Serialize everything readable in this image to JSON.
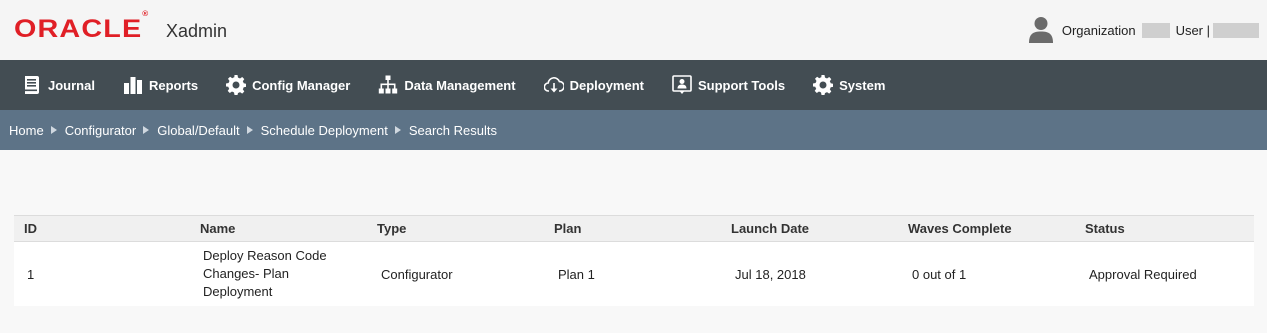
{
  "header": {
    "logo": "ORACLE",
    "logo_mark": "®",
    "app_name": "Xadmin",
    "org_label": "Organization",
    "user_label": "User |"
  },
  "nav": {
    "items": [
      {
        "label": "Journal",
        "icon": "journal-icon"
      },
      {
        "label": "Reports",
        "icon": "reports-icon"
      },
      {
        "label": "Config Manager",
        "icon": "gear-icon"
      },
      {
        "label": "Data Management",
        "icon": "hierarchy-icon"
      },
      {
        "label": "Deployment",
        "icon": "cloud-download-icon"
      },
      {
        "label": "Support Tools",
        "icon": "support-icon"
      },
      {
        "label": "System",
        "icon": "gear-icon"
      }
    ]
  },
  "breadcrumb": [
    "Home",
    "Configurator",
    "Global/Default",
    "Schedule Deployment",
    "Search Results"
  ],
  "table": {
    "headers": [
      "ID",
      "Name",
      "Type",
      "Plan",
      "Launch Date",
      "Waves Complete",
      "Status"
    ],
    "rows": [
      [
        "1",
        "Deploy Reason Code Changes- Plan Deployment",
        "Configurator",
        "Plan 1",
        "Jul 18, 2018",
        "0 out of 1",
        "Approval Required"
      ]
    ]
  },
  "colors": {
    "logo_red": "#e01f26",
    "nav_bg": "#434d53",
    "breadcrumb_bg": "#5d7387"
  }
}
